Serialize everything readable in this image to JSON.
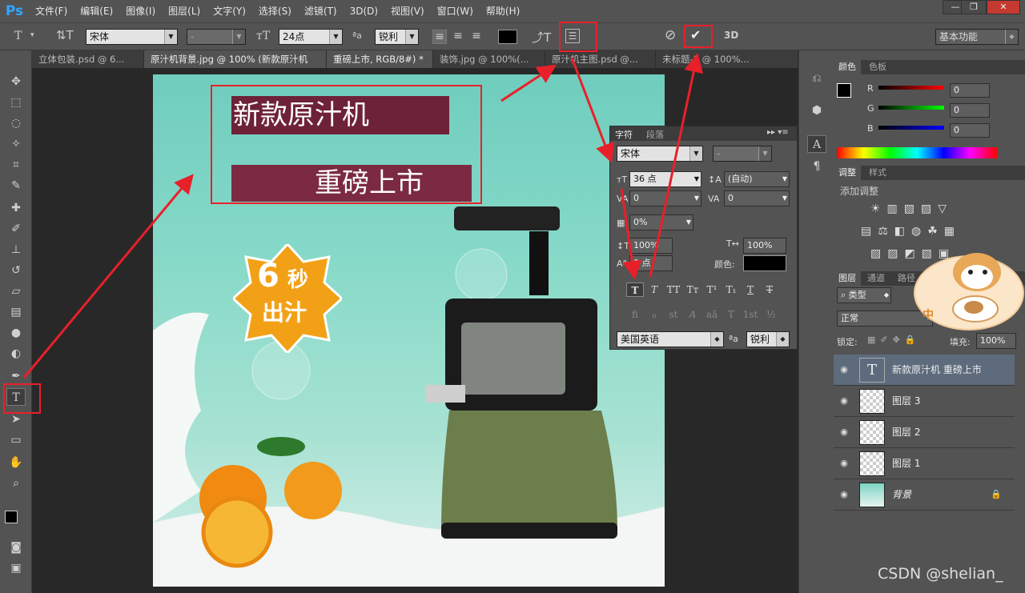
{
  "app": {
    "logo": "Ps",
    "window_controls": [
      "—",
      "❐",
      "✕"
    ]
  },
  "menu": [
    "文件(F)",
    "编辑(E)",
    "图像(I)",
    "图层(L)",
    "文字(Y)",
    "选择(S)",
    "滤镜(T)",
    "3D(D)",
    "视图(V)",
    "窗口(W)",
    "帮助(H)"
  ],
  "options": {
    "font_family": "宋体",
    "font_style": "-",
    "font_size": "24点",
    "aa_label": "ªa",
    "anti_alias": "锐利",
    "text_color": "#000000",
    "workspace": "基本功能",
    "threed": "3D"
  },
  "tabs": [
    "立体包装.psd @ 6...",
    "原汁机背景.jpg @ 100% (新款原汁机",
    "重磅上市, RGB/8#) *",
    "装饰.jpg @ 100%(...",
    "原汁机主图.psd @...",
    "未标题-1 @ 100%..."
  ],
  "canvas": {
    "headline1": "新款原汁机",
    "headline2": "重磅上市",
    "badge_line1": "6",
    "badge_line1b": "秒",
    "badge_line2": "出汁",
    "accent_colors": {
      "headline_bg": "#6e2237",
      "badge": "#f2a117",
      "juicer_body": "#6b7e4c"
    }
  },
  "character_panel": {
    "tabs": [
      "字符",
      "段落"
    ],
    "font_family": "宋体",
    "font_style": "-",
    "font_size": "36 点",
    "leading": "(自动)",
    "kerning": "0",
    "tracking": "0",
    "scale_tsume": "0%",
    "vertical_scale": "100%",
    "horizontal_scale": "100%",
    "baseline_shift": "0 点",
    "color_label": "颜色:",
    "typo_buttons": [
      "T",
      "T",
      "TT",
      "Tт",
      "T¹",
      "T₁",
      "T",
      "T"
    ],
    "opentype_buttons": [
      "fi",
      "ℴ",
      "st",
      "A",
      "aā",
      "T",
      "1st",
      "½"
    ],
    "language": "美国英语",
    "aa_label": "ªa",
    "anti_alias": "锐利"
  },
  "color_panel": {
    "tabs": [
      "颜色",
      "色板"
    ],
    "channels": [
      {
        "label": "R",
        "value": "0"
      },
      {
        "label": "G",
        "value": "0"
      },
      {
        "label": "B",
        "value": "0"
      }
    ]
  },
  "adjust_panel": {
    "tabs": [
      "调整",
      "样式"
    ],
    "title": "添加调整"
  },
  "layers_panel": {
    "tabs": [
      "图层",
      "通道",
      "路径"
    ],
    "kind": "类型",
    "blend": "正常",
    "lock_label": "锁定:",
    "fill_label": "填充:",
    "fill_value": "100%",
    "layers": [
      {
        "name": "新款原汁机    重磅上市",
        "type": "text"
      },
      {
        "name": "图层 3",
        "type": "image"
      },
      {
        "name": "图层 2",
        "type": "image"
      },
      {
        "name": "图层 1",
        "type": "image"
      },
      {
        "name": "背景",
        "type": "background"
      }
    ]
  },
  "sticker": {
    "label": "中"
  },
  "watermark": "CSDN @shelian_"
}
